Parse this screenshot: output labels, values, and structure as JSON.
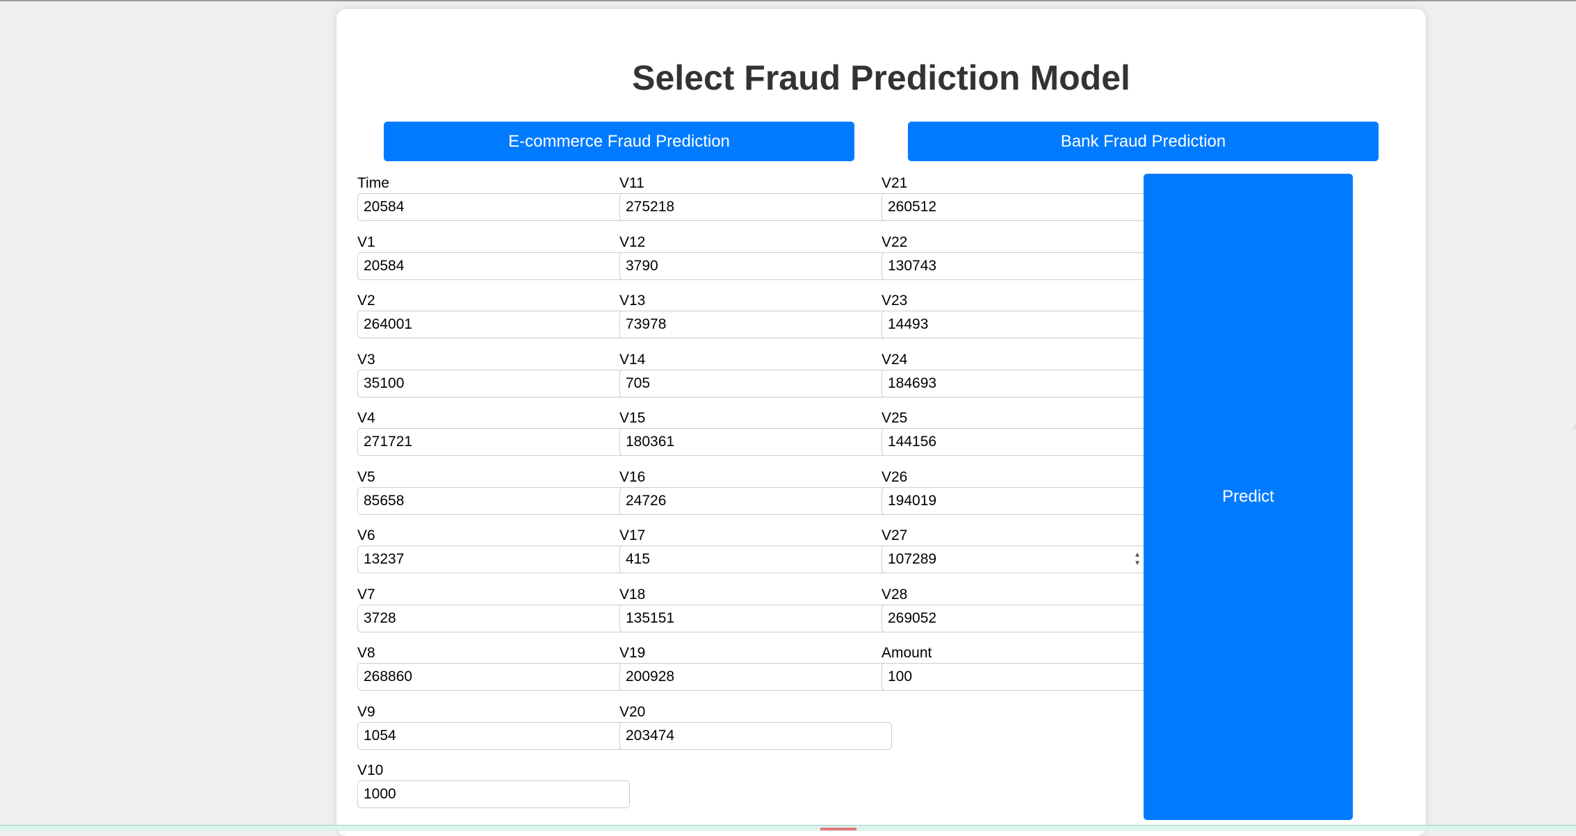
{
  "title": "Select Fraud Prediction Model",
  "buttons": {
    "ecommerce": "E-commerce Fraud Prediction",
    "bank": "Bank Fraud Prediction",
    "predict": "Predict"
  },
  "fields": [
    {
      "label": "Time",
      "value": "20584"
    },
    {
      "label": "V1",
      "value": "20584"
    },
    {
      "label": "V2",
      "value": "264001"
    },
    {
      "label": "V3",
      "value": "35100"
    },
    {
      "label": "V4",
      "value": "271721"
    },
    {
      "label": "V5",
      "value": "85658"
    },
    {
      "label": "V6",
      "value": "13237"
    },
    {
      "label": "V7",
      "value": "3728"
    },
    {
      "label": "V8",
      "value": "268860"
    },
    {
      "label": "V9",
      "value": "1054"
    },
    {
      "label": "V10",
      "value": "1000"
    },
    {
      "label": "V11",
      "value": "275218"
    },
    {
      "label": "V12",
      "value": "3790"
    },
    {
      "label": "V13",
      "value": "73978"
    },
    {
      "label": "V14",
      "value": "705"
    },
    {
      "label": "V15",
      "value": "180361"
    },
    {
      "label": "V16",
      "value": "24726"
    },
    {
      "label": "V17",
      "value": "415"
    },
    {
      "label": "V18",
      "value": "135151"
    },
    {
      "label": "V19",
      "value": "200928"
    },
    {
      "label": "V20",
      "value": "203474"
    },
    {
      "label": "V21",
      "value": "260512"
    },
    {
      "label": "V22",
      "value": "130743"
    },
    {
      "label": "V23",
      "value": "14493"
    },
    {
      "label": "V24",
      "value": "184693"
    },
    {
      "label": "V25",
      "value": "144156"
    },
    {
      "label": "V26",
      "value": "194019"
    },
    {
      "label": "V27",
      "value": "107289"
    },
    {
      "label": "V28",
      "value": "269052"
    },
    {
      "label": "Amount",
      "value": "100"
    }
  ]
}
